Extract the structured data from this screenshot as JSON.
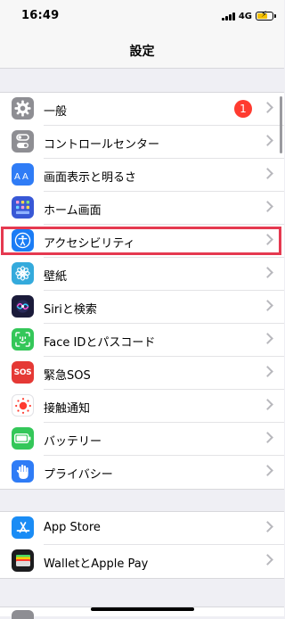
{
  "status": {
    "time": "16:49",
    "network": "4G"
  },
  "nav": {
    "title": "設定"
  },
  "groups": [
    {
      "items": [
        {
          "label": "一般",
          "icon": "gear-icon",
          "color": "#8e8e93",
          "badge": "1"
        },
        {
          "label": "コントロールセンター",
          "icon": "switches-icon",
          "color": "#8e8e93"
        },
        {
          "label": "画面表示と明るさ",
          "icon": "text-size-icon",
          "color": "#2f7cf6"
        },
        {
          "label": "ホーム画面",
          "icon": "grid-icon",
          "color": "#3858d6"
        },
        {
          "label": "アクセシビリティ",
          "icon": "accessibility-icon",
          "color": "#1a7cf5"
        },
        {
          "label": "壁紙",
          "icon": "flower-icon",
          "color": "#34aadc"
        },
        {
          "label": "Siriと検索",
          "icon": "siri-icon",
          "color": "#1b1b3a"
        },
        {
          "label": "Face IDとパスコード",
          "icon": "face-id-icon",
          "color": "#34c759"
        },
        {
          "label": "緊急SOS",
          "icon": "sos-icon",
          "color": "#e53935",
          "icon_text": "SOS"
        },
        {
          "label": "接触通知",
          "icon": "exposure-icon",
          "color": "#ffffff"
        },
        {
          "label": "バッテリー",
          "icon": "battery-icon",
          "color": "#34c759"
        },
        {
          "label": "プライバシー",
          "icon": "hand-icon",
          "color": "#2f7cf6"
        }
      ]
    },
    {
      "items": [
        {
          "label": "App Store",
          "icon": "app-store-icon",
          "color": "#1a8cf5"
        },
        {
          "label": "WalletとApple Pay",
          "icon": "wallet-icon",
          "color": "#1c1c1e"
        }
      ]
    }
  ]
}
